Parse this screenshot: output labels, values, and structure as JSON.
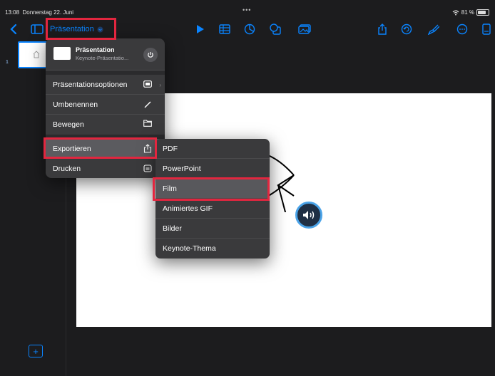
{
  "status": {
    "time": "13:08",
    "date": "Donnerstag 22. Juni",
    "dots": "•••",
    "battery": "81 %"
  },
  "toolbar": {
    "doc_title": "Präsentation"
  },
  "sidebar": {
    "slide_number": "1"
  },
  "menu": {
    "doc_name": "Präsentation",
    "doc_subtitle": "Keynote-Präsentatio...",
    "items": [
      {
        "label": "Präsentationsoptionen"
      },
      {
        "label": "Umbenennen"
      },
      {
        "label": "Bewegen"
      },
      {
        "label": "Exportieren"
      },
      {
        "label": "Drucken"
      }
    ]
  },
  "export_menu": {
    "items": [
      {
        "label": "PDF"
      },
      {
        "label": "PowerPoint"
      },
      {
        "label": "Film"
      },
      {
        "label": "Animiertes GIF"
      },
      {
        "label": "Bilder"
      },
      {
        "label": "Keynote-Thema"
      }
    ]
  },
  "colors": {
    "accent": "#0a84ff",
    "highlight": "#e2263f",
    "menu_bg": "#3a3a3c"
  }
}
